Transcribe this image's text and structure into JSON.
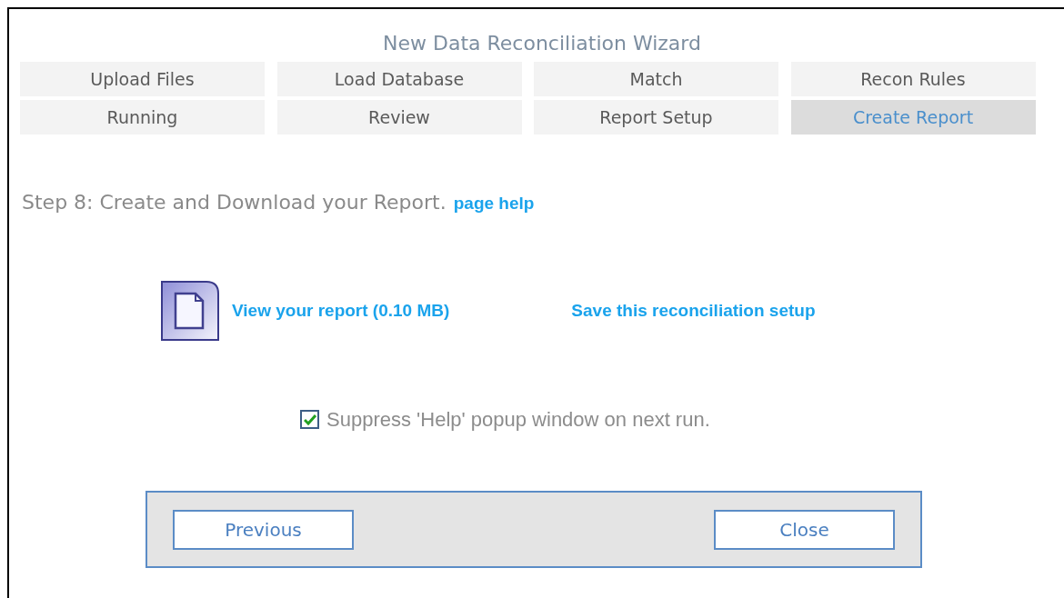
{
  "title": "New Data Reconciliation Wizard",
  "tabs": [
    {
      "label": "Upload Files",
      "selected": false
    },
    {
      "label": "Load Database",
      "selected": false
    },
    {
      "label": "Match",
      "selected": false
    },
    {
      "label": "Recon Rules",
      "selected": false
    },
    {
      "label": "Running",
      "selected": false
    },
    {
      "label": "Review",
      "selected": false
    },
    {
      "label": "Report Setup",
      "selected": false
    },
    {
      "label": "Create Report",
      "selected": true
    }
  ],
  "step": {
    "text": "Step 8: Create and Download your Report.",
    "help_link": "page help"
  },
  "actions": {
    "view_report": "View your report (0.10 MB)",
    "save_setup": "Save this reconciliation setup"
  },
  "suppress_help": {
    "label": "Suppress 'Help' popup window on next run.",
    "checked": true
  },
  "buttons": [
    "Previous",
    "Close"
  ]
}
